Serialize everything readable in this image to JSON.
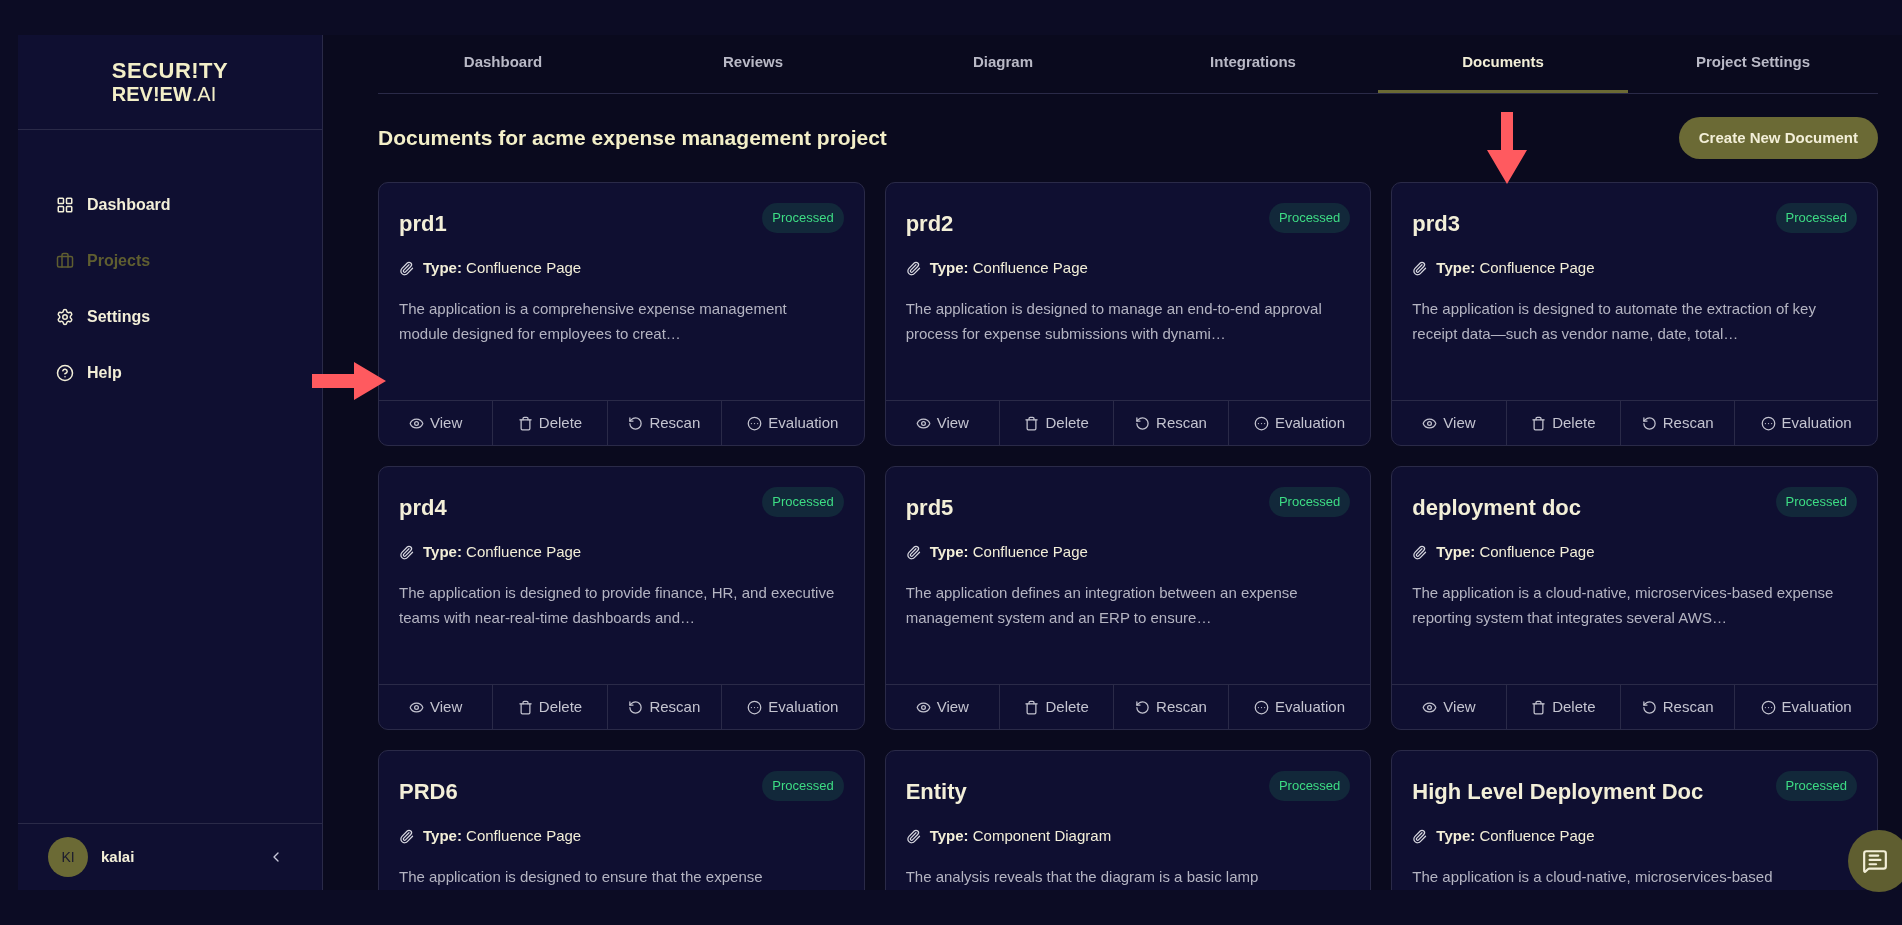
{
  "logo": {
    "line1": "SECUR!TY",
    "line2": "REV!EW",
    "suffix": ".AI"
  },
  "sidebar": {
    "items": [
      {
        "label": "Dashboard",
        "selected": false
      },
      {
        "label": "Projects",
        "selected": true
      },
      {
        "label": "Settings",
        "selected": false
      },
      {
        "label": "Help",
        "selected": false
      }
    ]
  },
  "user": {
    "initials": "KI",
    "name": "kalai"
  },
  "tabs": [
    {
      "label": "Dashboard",
      "selected": false
    },
    {
      "label": "Reviews",
      "selected": false
    },
    {
      "label": "Diagram",
      "selected": false
    },
    {
      "label": "Integrations",
      "selected": false
    },
    {
      "label": "Documents",
      "selected": true
    },
    {
      "label": "Project Settings",
      "selected": false
    }
  ],
  "heading": "Documents for acme expense management project",
  "create_button": "Create New Document",
  "documents": [
    {
      "title": "prd1",
      "status": "Processed",
      "type_label": "Type:",
      "type": "Confluence Page",
      "description": "The application is a comprehensive expense management module designed for employees to creat…",
      "actions": [
        {
          "kind": "view",
          "label": "View"
        },
        {
          "kind": "delete",
          "label": "Delete"
        },
        {
          "kind": "rescan",
          "label": "Rescan"
        },
        {
          "kind": "evaluation",
          "label": "Evaluation"
        }
      ]
    },
    {
      "title": "prd2",
      "status": "Processed",
      "type_label": "Type:",
      "type": "Confluence Page",
      "description": "The application is designed to manage an end-to-end approval process for expense submissions with dynami…",
      "actions": [
        {
          "kind": "view",
          "label": "View"
        },
        {
          "kind": "delete",
          "label": "Delete"
        },
        {
          "kind": "rescan",
          "label": "Rescan"
        },
        {
          "kind": "evaluation",
          "label": "Evaluation"
        }
      ]
    },
    {
      "title": "prd3",
      "status": "Processed",
      "type_label": "Type:",
      "type": "Confluence Page",
      "description": "The application is designed to automate the extraction of key receipt data—such as vendor name, date, total…",
      "actions": [
        {
          "kind": "view",
          "label": "View"
        },
        {
          "kind": "delete",
          "label": "Delete"
        },
        {
          "kind": "rescan",
          "label": "Rescan"
        },
        {
          "kind": "evaluation",
          "label": "Evaluation"
        }
      ]
    },
    {
      "title": "prd4",
      "status": "Processed",
      "type_label": "Type:",
      "type": "Confluence Page",
      "description": "The application is designed to provide finance, HR, and executive teams with near-real-time dashboards and…",
      "actions": [
        {
          "kind": "view",
          "label": "View"
        },
        {
          "kind": "delete",
          "label": "Delete"
        },
        {
          "kind": "rescan",
          "label": "Rescan"
        },
        {
          "kind": "evaluation",
          "label": "Evaluation"
        }
      ]
    },
    {
      "title": "prd5",
      "status": "Processed",
      "type_label": "Type:",
      "type": "Confluence Page",
      "description": "The application defines an integration between an expense management system and an ERP to ensure…",
      "actions": [
        {
          "kind": "view",
          "label": "View"
        },
        {
          "kind": "delete",
          "label": "Delete"
        },
        {
          "kind": "rescan",
          "label": "Rescan"
        },
        {
          "kind": "evaluation",
          "label": "Evaluation"
        }
      ]
    },
    {
      "title": "deployment doc",
      "status": "Processed",
      "type_label": "Type:",
      "type": "Confluence Page",
      "description": "The application is a cloud-native, microservices-based expense reporting system that integrates several AWS…",
      "actions": [
        {
          "kind": "view",
          "label": "View"
        },
        {
          "kind": "delete",
          "label": "Delete"
        },
        {
          "kind": "rescan",
          "label": "Rescan"
        },
        {
          "kind": "evaluation",
          "label": "Evaluation"
        }
      ]
    },
    {
      "title": "PRD6",
      "status": "Processed",
      "type_label": "Type:",
      "type": "Confluence Page",
      "description": "The application is designed to ensure that the expense"
    },
    {
      "title": "Entity",
      "status": "Processed",
      "type_label": "Type:",
      "type": "Component Diagram",
      "description": "The analysis reveals that the diagram is a basic lamp"
    },
    {
      "title": "High Level Deployment Doc",
      "status": "Processed",
      "type_label": "Type:",
      "type": "Confluence Page",
      "description": "The application is a cloud-native, microservices-based"
    }
  ]
}
